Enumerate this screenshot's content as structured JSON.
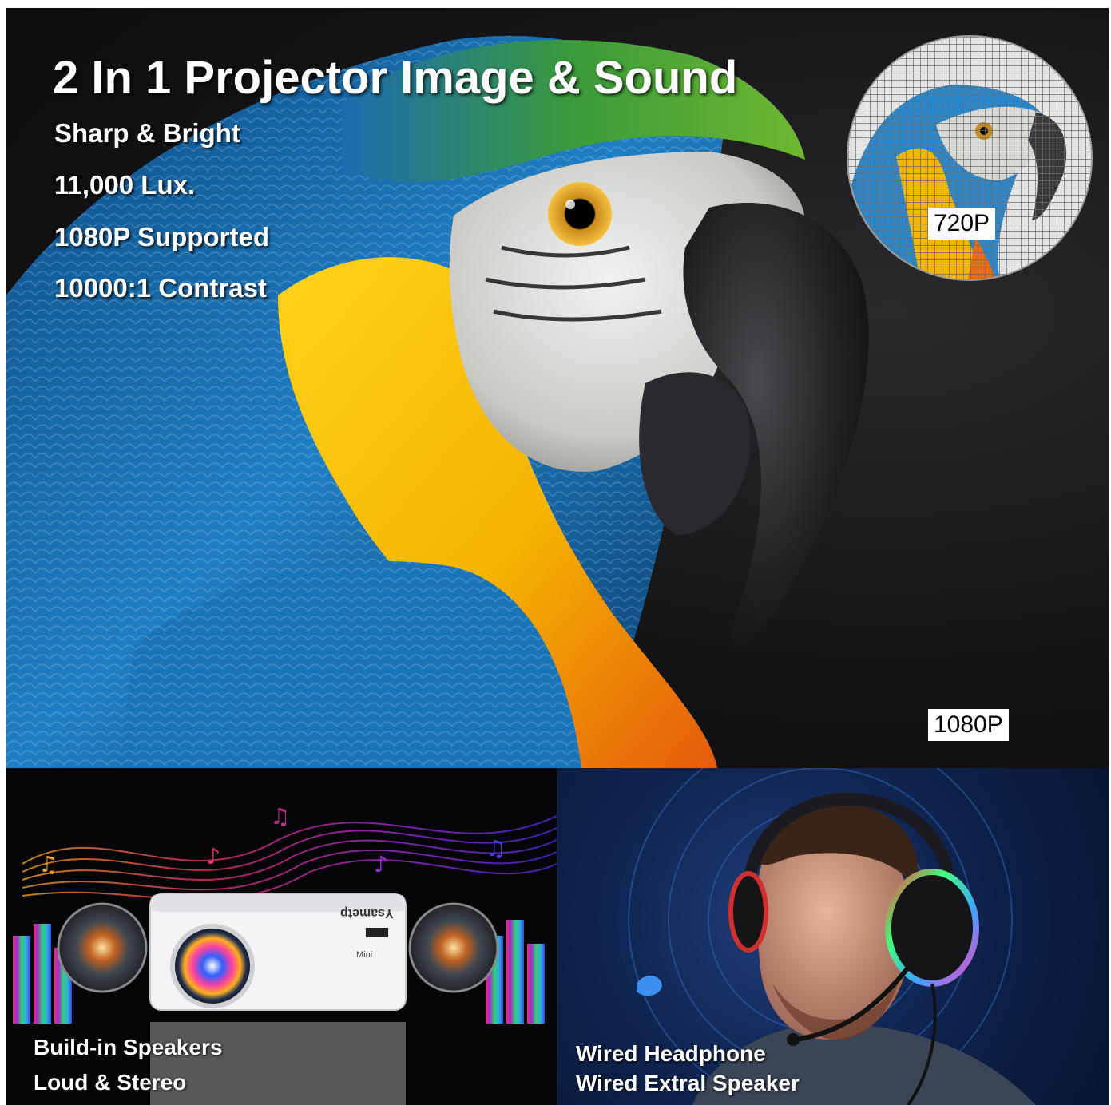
{
  "hero": {
    "title": "2 In 1 Projector Image & Sound",
    "features": [
      "Sharp & Bright",
      "11,000 Lux.",
      "1080P Supported",
      "10000:1 Contrast"
    ],
    "inset_label": "720P",
    "main_label": "1080P"
  },
  "speakers_panel": {
    "caption_line1": "Build-in Speakers",
    "caption_line2": "Loud & Stereo",
    "projector_brand": "Ysametp",
    "projector_model": "Mini"
  },
  "headphone_panel": {
    "caption_line1": "Wired Headphone",
    "caption_line2": "Wired Extral Speaker"
  },
  "colors": {
    "parrot_blue": "#1f7fc4",
    "parrot_yellow": "#f5b400",
    "parrot_orange": "#ee6a10",
    "parrot_green": "#3a9b3a",
    "headphone_bg": "#0f2450"
  }
}
